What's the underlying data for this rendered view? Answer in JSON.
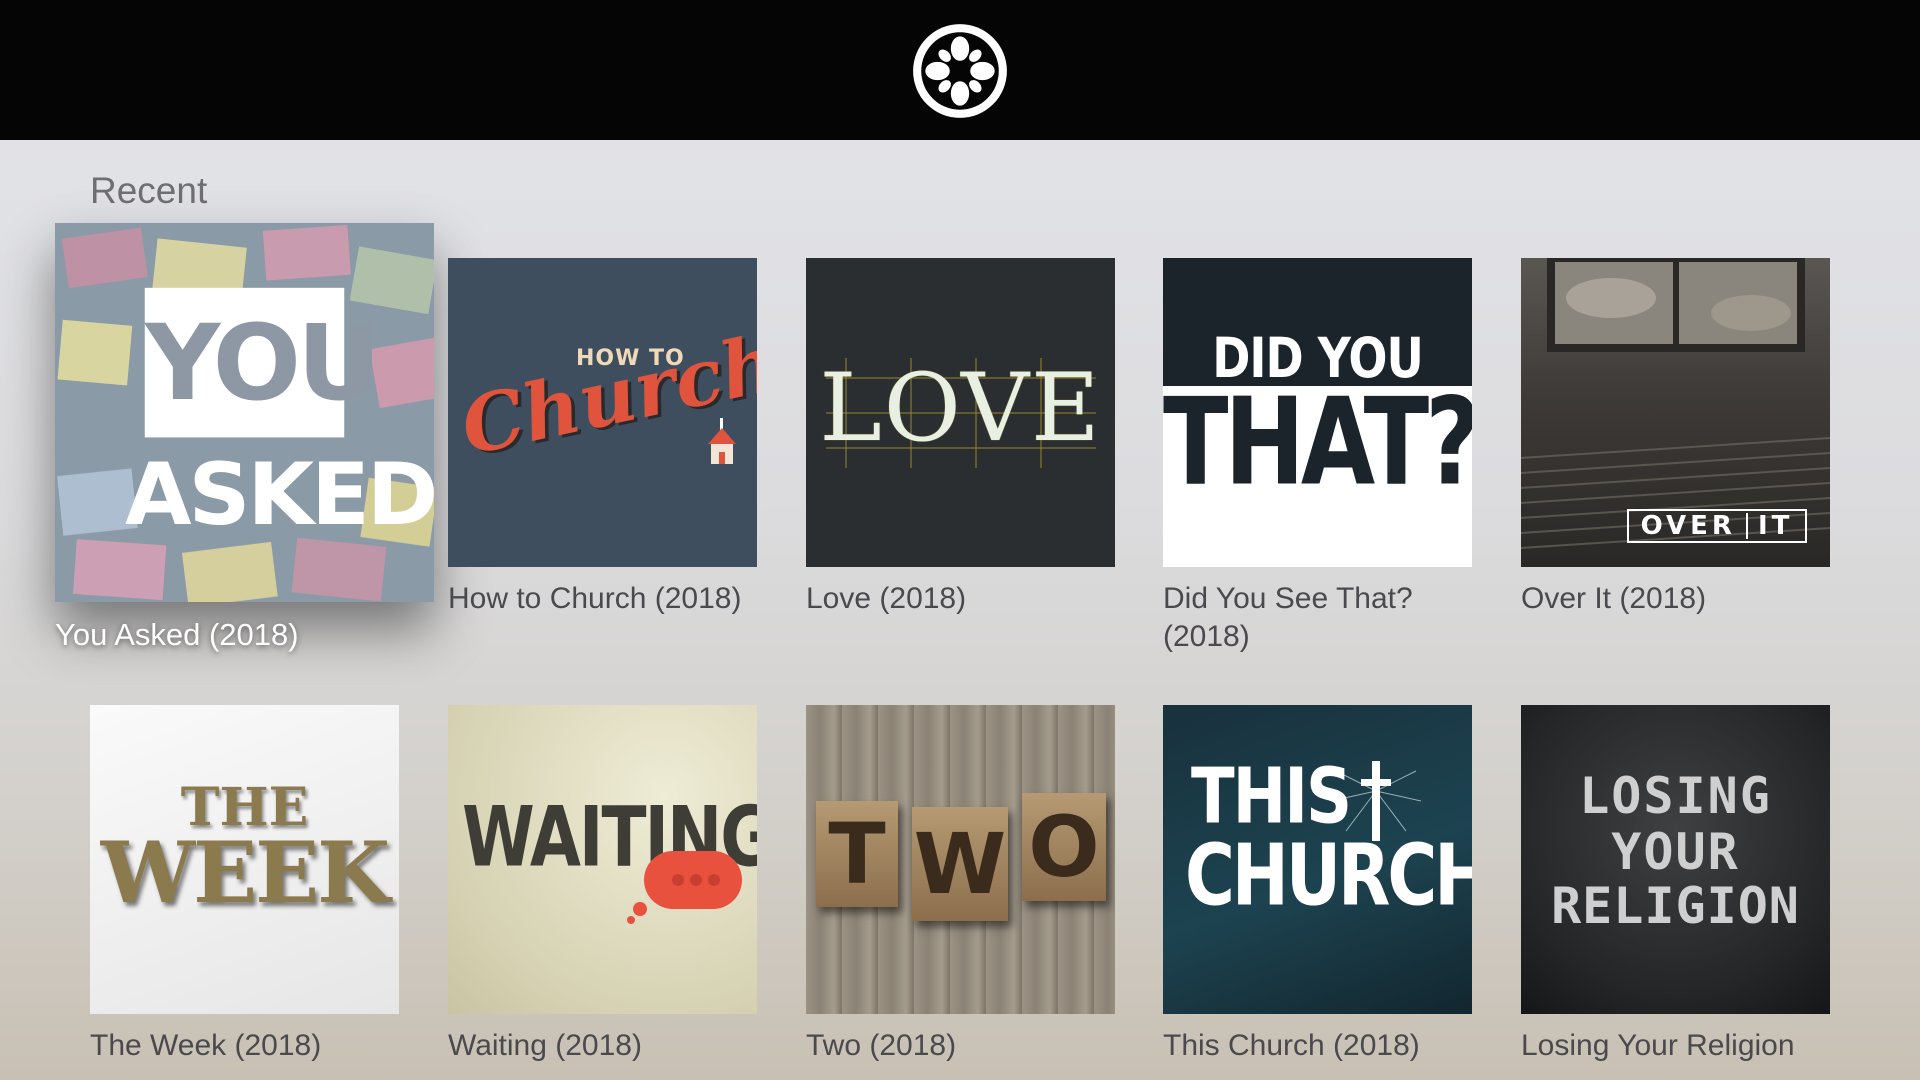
{
  "header": {
    "logo_icon": "church-knot-logo"
  },
  "section": {
    "title": "Recent"
  },
  "items": [
    {
      "title": "You Asked (2018)",
      "art_lines": [
        "YOU",
        "ASKED"
      ]
    },
    {
      "title": "How to Church (2018)",
      "art_lines": [
        "HOW TO",
        "Church"
      ]
    },
    {
      "title": "Love (2018)",
      "art_lines": [
        "LOVE"
      ]
    },
    {
      "title": "Did You See That? (2018)",
      "art_lines": [
        "DID YOU SEE",
        "THAT?"
      ]
    },
    {
      "title": "Over It (2018)",
      "art_lines": [
        "OVER",
        "IT"
      ]
    },
    {
      "title": "The Week (2018)",
      "art_lines": [
        "THE",
        "WEEK"
      ]
    },
    {
      "title": "Waiting (2018)",
      "art_lines": [
        "WAITING"
      ]
    },
    {
      "title": "Two (2018)",
      "art_lines": [
        "T",
        "W",
        "O"
      ]
    },
    {
      "title": "This Church (2018)",
      "art_lines": [
        "THIS",
        "CHURCH"
      ]
    },
    {
      "title": "Losing Your Religion",
      "art_lines": [
        "LOSING",
        "YOUR",
        "RELIGION"
      ]
    }
  ],
  "colors": {
    "header_bg": "#050505",
    "focused_caption": "#ffffff",
    "caption": "#4a4a4e"
  }
}
